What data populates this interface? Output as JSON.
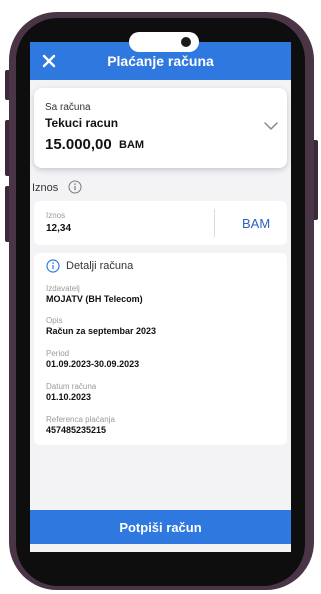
{
  "header": {
    "title": "Plaćanje računa",
    "close_icon": "close-icon"
  },
  "account": {
    "caption": "Sa računa",
    "name": "Tekuci racun",
    "balance": "15.000,00",
    "currency": "BAM"
  },
  "amount_section": {
    "label": "Iznos",
    "field_caption": "Iznos",
    "value": "12,34",
    "currency": "BAM"
  },
  "details": {
    "title": "Detalji računa",
    "fields": [
      {
        "label": "Izdavatelj",
        "value": "MOJATV (BH Telecom)"
      },
      {
        "label": "Opis",
        "value": "Račun za septembar 2023"
      },
      {
        "label": "Period",
        "value": "01.09.2023-30.09.2023"
      },
      {
        "label": "Datum računa",
        "value": "01.10.2023"
      },
      {
        "label": "Referenca plaćanja",
        "value": "457485235215"
      }
    ]
  },
  "footer": {
    "sign_label": "Potpiši račun"
  },
  "colors": {
    "accent": "#2f78e0",
    "frame": "#4a3547",
    "background": "#f3f3f6"
  }
}
